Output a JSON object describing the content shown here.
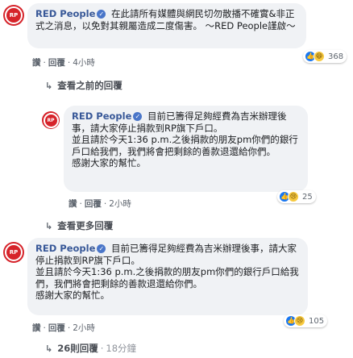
{
  "comments": [
    {
      "author": "RED People",
      "text": "在此請所有媒體與網民切勿散播不確實&非正式之消息，以免對其親屬造成二度傷害。 ～RED People謹啟～",
      "actions": [
        "讚",
        "回覆",
        "4小時"
      ],
      "reactions": [
        "like",
        "haha"
      ],
      "reaction_count": "368"
    },
    {
      "author": "RED People",
      "text_lines": [
        "目前已籌得足夠經費為吉米辦理後事，請大家停止捐款到RP旗下戶口。",
        "並且請於今天1:36 p.m.之後捐款的朋友pm你們的銀行戶口給我們，我們將會把剩餘的善款退還給你們。",
        "感謝大家的幫忙。"
      ],
      "actions": [
        "讚",
        "回覆",
        "2小時"
      ],
      "reactions": [
        "like",
        "sad"
      ],
      "reaction_count": "25"
    },
    {
      "author": "RED People",
      "text_lines": [
        "目前已籌得足夠經費為吉米辦理後事，請大家停止捐款到RP旗下戶口。",
        "並且請於今天1:36 p.m.之後捐款的朋友pm你們的銀行戶口給我們，我們將會把剩餘的善款退還給你們。",
        "感謝大家的幫忙。"
      ],
      "actions": [
        "讚",
        "回覆",
        "2小時"
      ],
      "reactions": [
        "like",
        "sad"
      ],
      "reaction_count": "105"
    }
  ],
  "links": {
    "previous_replies": "查看之前的回覆",
    "more_replies": "查看更多回覆",
    "reply_count": "26則回覆",
    "reply_time": "18分鐘"
  },
  "avatar_text": "RP"
}
